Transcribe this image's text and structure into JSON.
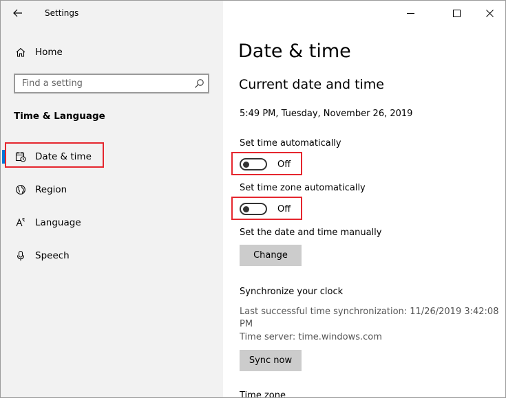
{
  "window": {
    "title": "Settings",
    "controls": {
      "minimize": "minimize-icon",
      "maximize": "maximize-icon",
      "close": "close-icon"
    }
  },
  "sidebar": {
    "back_icon": "back-arrow-icon",
    "home": {
      "label": "Home",
      "icon": "home-icon"
    },
    "search": {
      "placeholder": "Find a setting",
      "value": "",
      "icon": "search-icon"
    },
    "section": "Time & Language",
    "items": [
      {
        "label": "Date & time",
        "icon": "calendar-clock-icon",
        "active": true
      },
      {
        "label": "Region",
        "icon": "globe-icon",
        "active": false
      },
      {
        "label": "Language",
        "icon": "language-icon",
        "active": false
      },
      {
        "label": "Speech",
        "icon": "microphone-icon",
        "active": false
      }
    ],
    "accent_color": "#0078d7"
  },
  "main": {
    "title": "Date & time",
    "section_title": "Current date and time",
    "current_datetime": "5:49 PM, Tuesday, November 26, 2019",
    "set_time_auto": {
      "label": "Set time automatically",
      "state": "Off"
    },
    "set_timezone_auto": {
      "label": "Set time zone automatically",
      "state": "Off"
    },
    "manual": {
      "label": "Set the date and time manually",
      "button": "Change"
    },
    "sync": {
      "heading": "Synchronize your clock",
      "last_sync_line1": "Last successful time synchronization: 11/26/2019 3:42:08",
      "last_sync_line2": "PM",
      "server": "Time server: time.windows.com",
      "button": "Sync now"
    },
    "next_section_heading": "Time zone"
  },
  "highlight_color": "#e5262e"
}
